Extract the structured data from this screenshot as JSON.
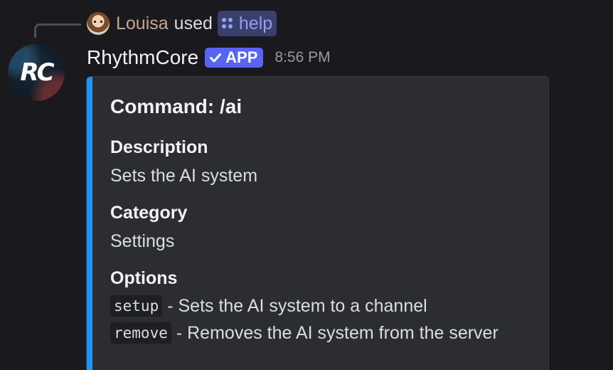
{
  "reply": {
    "username": "Louisa",
    "action_text": "used",
    "command_name": "help",
    "avatar_icon": "user-avatar-icon"
  },
  "message": {
    "author": "RhythmCore",
    "badge_label": "APP",
    "badge_icon": "check-icon",
    "timestamp": "8:56 PM",
    "avatar_text": "RC",
    "accent_color": "#1a94ff"
  },
  "embed": {
    "title": "Command: /ai",
    "fields": [
      {
        "name": "Description",
        "value": "Sets the AI system"
      },
      {
        "name": "Category",
        "value": "Settings"
      },
      {
        "name": "Options"
      }
    ],
    "options": [
      {
        "code": "setup",
        "text": "- Sets the AI system to a channel"
      },
      {
        "code": "remove",
        "text": "- Removes the AI system from the server"
      }
    ]
  }
}
